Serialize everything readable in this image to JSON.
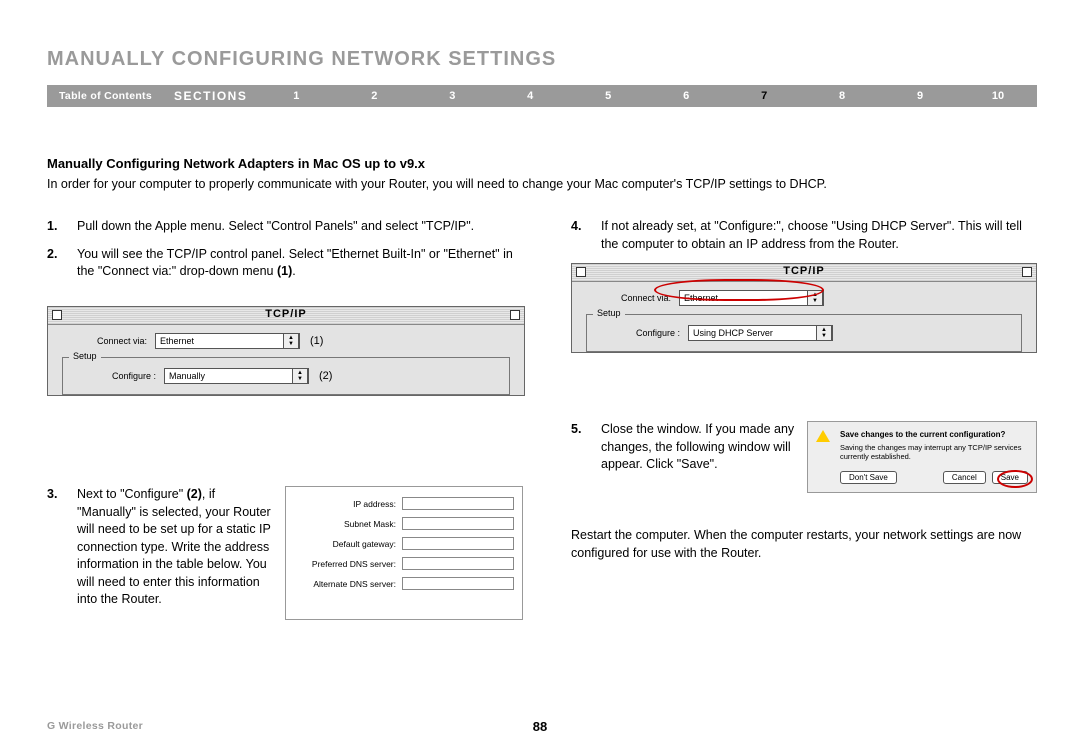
{
  "title": "MANUALLY CONFIGURING NETWORK SETTINGS",
  "nav": {
    "toc": "Table of Contents",
    "sections": "SECTIONS",
    "items": [
      "1",
      "2",
      "3",
      "4",
      "5",
      "6",
      "7",
      "8",
      "9",
      "10"
    ],
    "active_index": 6
  },
  "subheading": "Manually Configuring Network Adapters in Mac OS up to v9.x",
  "intro": "In order for your computer to properly communicate with your Router, you will need to change your Mac computer's TCP/IP settings to DHCP.",
  "left_steps": {
    "s1_num": "1.",
    "s1": "Pull down the Apple menu. Select \"Control Panels\" and select \"TCP/IP\".",
    "s2_num": "2.",
    "s2a": "You will see the TCP/IP control panel. Select \"Ethernet Built-In\" or \"Ethernet\" in the \"Connect via:\" drop-down menu ",
    "s2b": "(1)",
    "s2c": ".",
    "s3_num": "3.",
    "s3a": "Next to \"Configure\" ",
    "s3b": "(2)",
    "s3c": ", if \"Manually\" is selected, your Router will need to be set up for a static IP connection type. Write the address information in the table below. You will need to enter this information into the Router."
  },
  "right_steps": {
    "s4_num": "4.",
    "s4": "If not already set, at \"Configure:\", choose \"Using DHCP Server\". This will tell the computer to obtain an IP address from the Router.",
    "s5_num": "5.",
    "s5": "Close the window. If you made any changes, the following window will appear. Click \"Save\".",
    "restart": "Restart the computer. When the computer restarts, your network settings are now configured for use with the Router."
  },
  "tcpip": {
    "title": "TCP/IP",
    "connect_label": "Connect via:",
    "connect_value_ethernet": "Ethernet",
    "setup_label": "Setup",
    "configure_label": "Configure :",
    "configure_manually": "Manually",
    "configure_dhcp": "Using DHCP Server",
    "callout1": "(1)",
    "callout2": "(2)"
  },
  "ipfields": {
    "ip": "IP address:",
    "subnet": "Subnet Mask:",
    "gateway": "Default gateway:",
    "pdns": "Preferred DNS server:",
    "adns": "Alternate DNS server:"
  },
  "dialog": {
    "msg1": "Save changes to the current configuration?",
    "msg2": "Saving the changes may interrupt any TCP/IP services currently established.",
    "dont_save": "Don't Save",
    "cancel": "Cancel",
    "save": "Save"
  },
  "footer": {
    "product": "G Wireless Router",
    "page": "88"
  }
}
